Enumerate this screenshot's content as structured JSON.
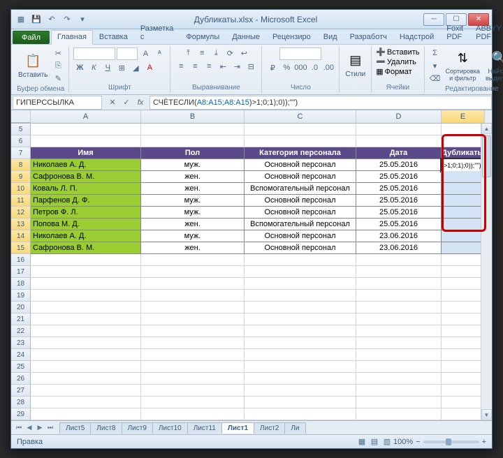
{
  "title": "Дубликаты.xlsx - Microsoft Excel",
  "tabs": {
    "file": "Файл",
    "home": "Главная",
    "insert": "Вставка",
    "layout": "Разметка с",
    "formulas": "Формулы",
    "data": "Данные",
    "review": "Рецензиро",
    "view": "Вид",
    "dev": "Разработч",
    "addins": "Надстрой",
    "foxit": "Foxit PDF",
    "abbyy": "ABBYY PDF"
  },
  "groups": {
    "clipboard": "Буфер обмена",
    "font": "Шрифт",
    "align": "Выравнивание",
    "number": "Число",
    "styles": "Стили",
    "cells": "Ячейки",
    "editing": "Редактирование"
  },
  "paste": "Вставить",
  "styles_btn": "Стили",
  "insert_btn": "Вставить",
  "delete_btn": "Удалить",
  "format_btn": "Формат",
  "sort_btn": "Сортировка и фильтр",
  "find_btn": "Найти и выделить",
  "name_box": "ГИПЕРССЫЛКА",
  "formula_pre": "СЧЁТЕСЛИ(",
  "formula_ref": "A8:A15;A8:A15",
  "formula_post": ")>1;0;1);0));\"\")",
  "headers": {
    "A": "Имя",
    "B": "Пол",
    "C": "Категория персонала",
    "D": "Дата",
    "E": "Дубликаты"
  },
  "rows": [
    {
      "n": "Николаев А. Д.",
      "g": "муж.",
      "c": "Основной персонал",
      "d": "25.05.2016"
    },
    {
      "n": "Сафронова В. М.",
      "g": "жен.",
      "c": "Основной персонал",
      "d": "25.05.2016"
    },
    {
      "n": "Коваль Л. П.",
      "g": "жен.",
      "c": "Вспомогательный персонал",
      "d": "25.05.2016"
    },
    {
      "n": "Парфенов Д. Ф.",
      "g": "муж.",
      "c": "Основной персонал",
      "d": "25.05.2016"
    },
    {
      "n": "Петров Ф. Л.",
      "g": "муж.",
      "c": "Основной персонал",
      "d": "25.05.2016"
    },
    {
      "n": "Попова М. Д.",
      "g": "жен.",
      "c": "Вспомогательный персонал",
      "d": "25.05.2016"
    },
    {
      "n": "Николаев А. Д.",
      "g": "муж.",
      "c": "Основной персонал",
      "d": "23.06.2016"
    },
    {
      "n": "Сафронова В. М.",
      "g": "жен.",
      "c": "Основной персонал",
      "d": "23.06.2016"
    }
  ],
  "editing_cell": ">1;0;1);0));\"\")",
  "sheets": [
    "Лист5",
    "Лист8",
    "Лист9",
    "Лист10",
    "Лист11",
    "Лист1",
    "Лист2",
    "Ли"
  ],
  "active_sheet": "Лист1",
  "status": "Правка",
  "zoom": "100%",
  "cols": [
    "A",
    "B",
    "C",
    "D",
    "E"
  ]
}
